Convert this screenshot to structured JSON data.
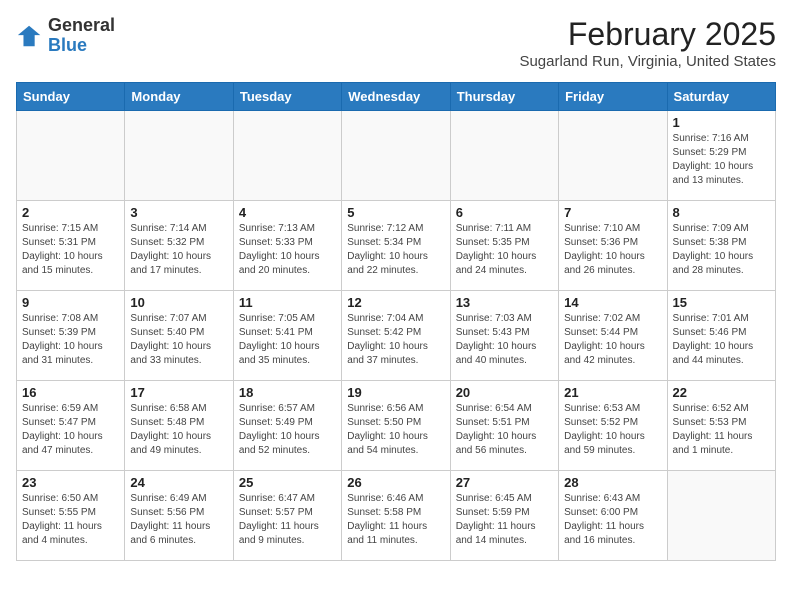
{
  "header": {
    "logo_general": "General",
    "logo_blue": "Blue",
    "month_title": "February 2025",
    "location": "Sugarland Run, Virginia, United States"
  },
  "weekdays": [
    "Sunday",
    "Monday",
    "Tuesday",
    "Wednesday",
    "Thursday",
    "Friday",
    "Saturday"
  ],
  "weeks": [
    [
      {
        "day": "",
        "info": ""
      },
      {
        "day": "",
        "info": ""
      },
      {
        "day": "",
        "info": ""
      },
      {
        "day": "",
        "info": ""
      },
      {
        "day": "",
        "info": ""
      },
      {
        "day": "",
        "info": ""
      },
      {
        "day": "1",
        "info": "Sunrise: 7:16 AM\nSunset: 5:29 PM\nDaylight: 10 hours and 13 minutes."
      }
    ],
    [
      {
        "day": "2",
        "info": "Sunrise: 7:15 AM\nSunset: 5:31 PM\nDaylight: 10 hours and 15 minutes."
      },
      {
        "day": "3",
        "info": "Sunrise: 7:14 AM\nSunset: 5:32 PM\nDaylight: 10 hours and 17 minutes."
      },
      {
        "day": "4",
        "info": "Sunrise: 7:13 AM\nSunset: 5:33 PM\nDaylight: 10 hours and 20 minutes."
      },
      {
        "day": "5",
        "info": "Sunrise: 7:12 AM\nSunset: 5:34 PM\nDaylight: 10 hours and 22 minutes."
      },
      {
        "day": "6",
        "info": "Sunrise: 7:11 AM\nSunset: 5:35 PM\nDaylight: 10 hours and 24 minutes."
      },
      {
        "day": "7",
        "info": "Sunrise: 7:10 AM\nSunset: 5:36 PM\nDaylight: 10 hours and 26 minutes."
      },
      {
        "day": "8",
        "info": "Sunrise: 7:09 AM\nSunset: 5:38 PM\nDaylight: 10 hours and 28 minutes."
      }
    ],
    [
      {
        "day": "9",
        "info": "Sunrise: 7:08 AM\nSunset: 5:39 PM\nDaylight: 10 hours and 31 minutes."
      },
      {
        "day": "10",
        "info": "Sunrise: 7:07 AM\nSunset: 5:40 PM\nDaylight: 10 hours and 33 minutes."
      },
      {
        "day": "11",
        "info": "Sunrise: 7:05 AM\nSunset: 5:41 PM\nDaylight: 10 hours and 35 minutes."
      },
      {
        "day": "12",
        "info": "Sunrise: 7:04 AM\nSunset: 5:42 PM\nDaylight: 10 hours and 37 minutes."
      },
      {
        "day": "13",
        "info": "Sunrise: 7:03 AM\nSunset: 5:43 PM\nDaylight: 10 hours and 40 minutes."
      },
      {
        "day": "14",
        "info": "Sunrise: 7:02 AM\nSunset: 5:44 PM\nDaylight: 10 hours and 42 minutes."
      },
      {
        "day": "15",
        "info": "Sunrise: 7:01 AM\nSunset: 5:46 PM\nDaylight: 10 hours and 44 minutes."
      }
    ],
    [
      {
        "day": "16",
        "info": "Sunrise: 6:59 AM\nSunset: 5:47 PM\nDaylight: 10 hours and 47 minutes."
      },
      {
        "day": "17",
        "info": "Sunrise: 6:58 AM\nSunset: 5:48 PM\nDaylight: 10 hours and 49 minutes."
      },
      {
        "day": "18",
        "info": "Sunrise: 6:57 AM\nSunset: 5:49 PM\nDaylight: 10 hours and 52 minutes."
      },
      {
        "day": "19",
        "info": "Sunrise: 6:56 AM\nSunset: 5:50 PM\nDaylight: 10 hours and 54 minutes."
      },
      {
        "day": "20",
        "info": "Sunrise: 6:54 AM\nSunset: 5:51 PM\nDaylight: 10 hours and 56 minutes."
      },
      {
        "day": "21",
        "info": "Sunrise: 6:53 AM\nSunset: 5:52 PM\nDaylight: 10 hours and 59 minutes."
      },
      {
        "day": "22",
        "info": "Sunrise: 6:52 AM\nSunset: 5:53 PM\nDaylight: 11 hours and 1 minute."
      }
    ],
    [
      {
        "day": "23",
        "info": "Sunrise: 6:50 AM\nSunset: 5:55 PM\nDaylight: 11 hours and 4 minutes."
      },
      {
        "day": "24",
        "info": "Sunrise: 6:49 AM\nSunset: 5:56 PM\nDaylight: 11 hours and 6 minutes."
      },
      {
        "day": "25",
        "info": "Sunrise: 6:47 AM\nSunset: 5:57 PM\nDaylight: 11 hours and 9 minutes."
      },
      {
        "day": "26",
        "info": "Sunrise: 6:46 AM\nSunset: 5:58 PM\nDaylight: 11 hours and 11 minutes."
      },
      {
        "day": "27",
        "info": "Sunrise: 6:45 AM\nSunset: 5:59 PM\nDaylight: 11 hours and 14 minutes."
      },
      {
        "day": "28",
        "info": "Sunrise: 6:43 AM\nSunset: 6:00 PM\nDaylight: 11 hours and 16 minutes."
      },
      {
        "day": "",
        "info": ""
      }
    ]
  ]
}
